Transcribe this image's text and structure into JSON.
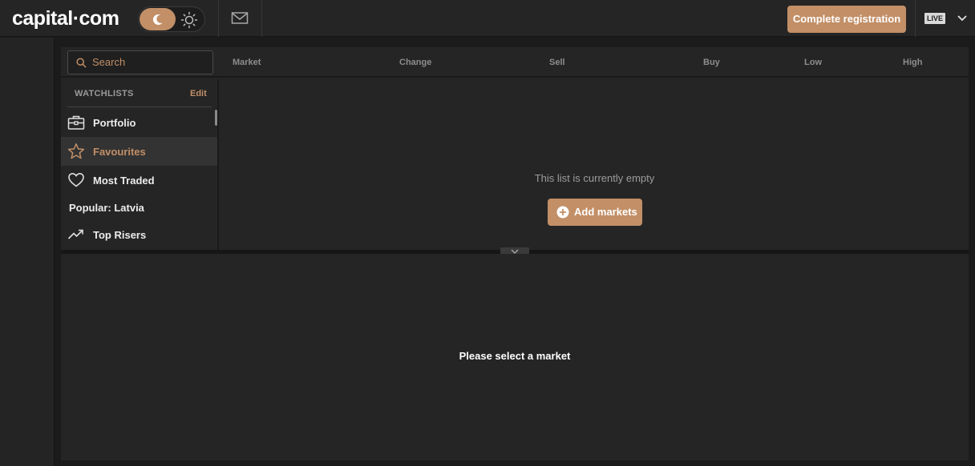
{
  "header": {
    "logo": "capital·com",
    "complete_registration": "Complete registration",
    "live_badge": "LIVE"
  },
  "search": {
    "placeholder": "Search"
  },
  "columns": [
    "Market",
    "Change",
    "Sell",
    "Buy",
    "Low",
    "High"
  ],
  "watchlists": {
    "title": "WATCHLISTS",
    "edit": "Edit",
    "items": [
      {
        "label": "Portfolio",
        "icon": "portfolio-icon"
      },
      {
        "label": "Favourites",
        "icon": "star-icon",
        "active": true
      },
      {
        "label": "Most Traded",
        "icon": "heart-icon"
      },
      {
        "label": "Popular: Latvia",
        "icon": ""
      },
      {
        "label": "Top Risers",
        "icon": "trending-up-icon"
      }
    ]
  },
  "main": {
    "empty_text": "This list is currently empty",
    "add_markets": "Add markets"
  },
  "bottom": {
    "message": "Please select a market"
  },
  "colors": {
    "accent": "#c28f67",
    "background": "#252525",
    "page": "#1b1b1b"
  }
}
